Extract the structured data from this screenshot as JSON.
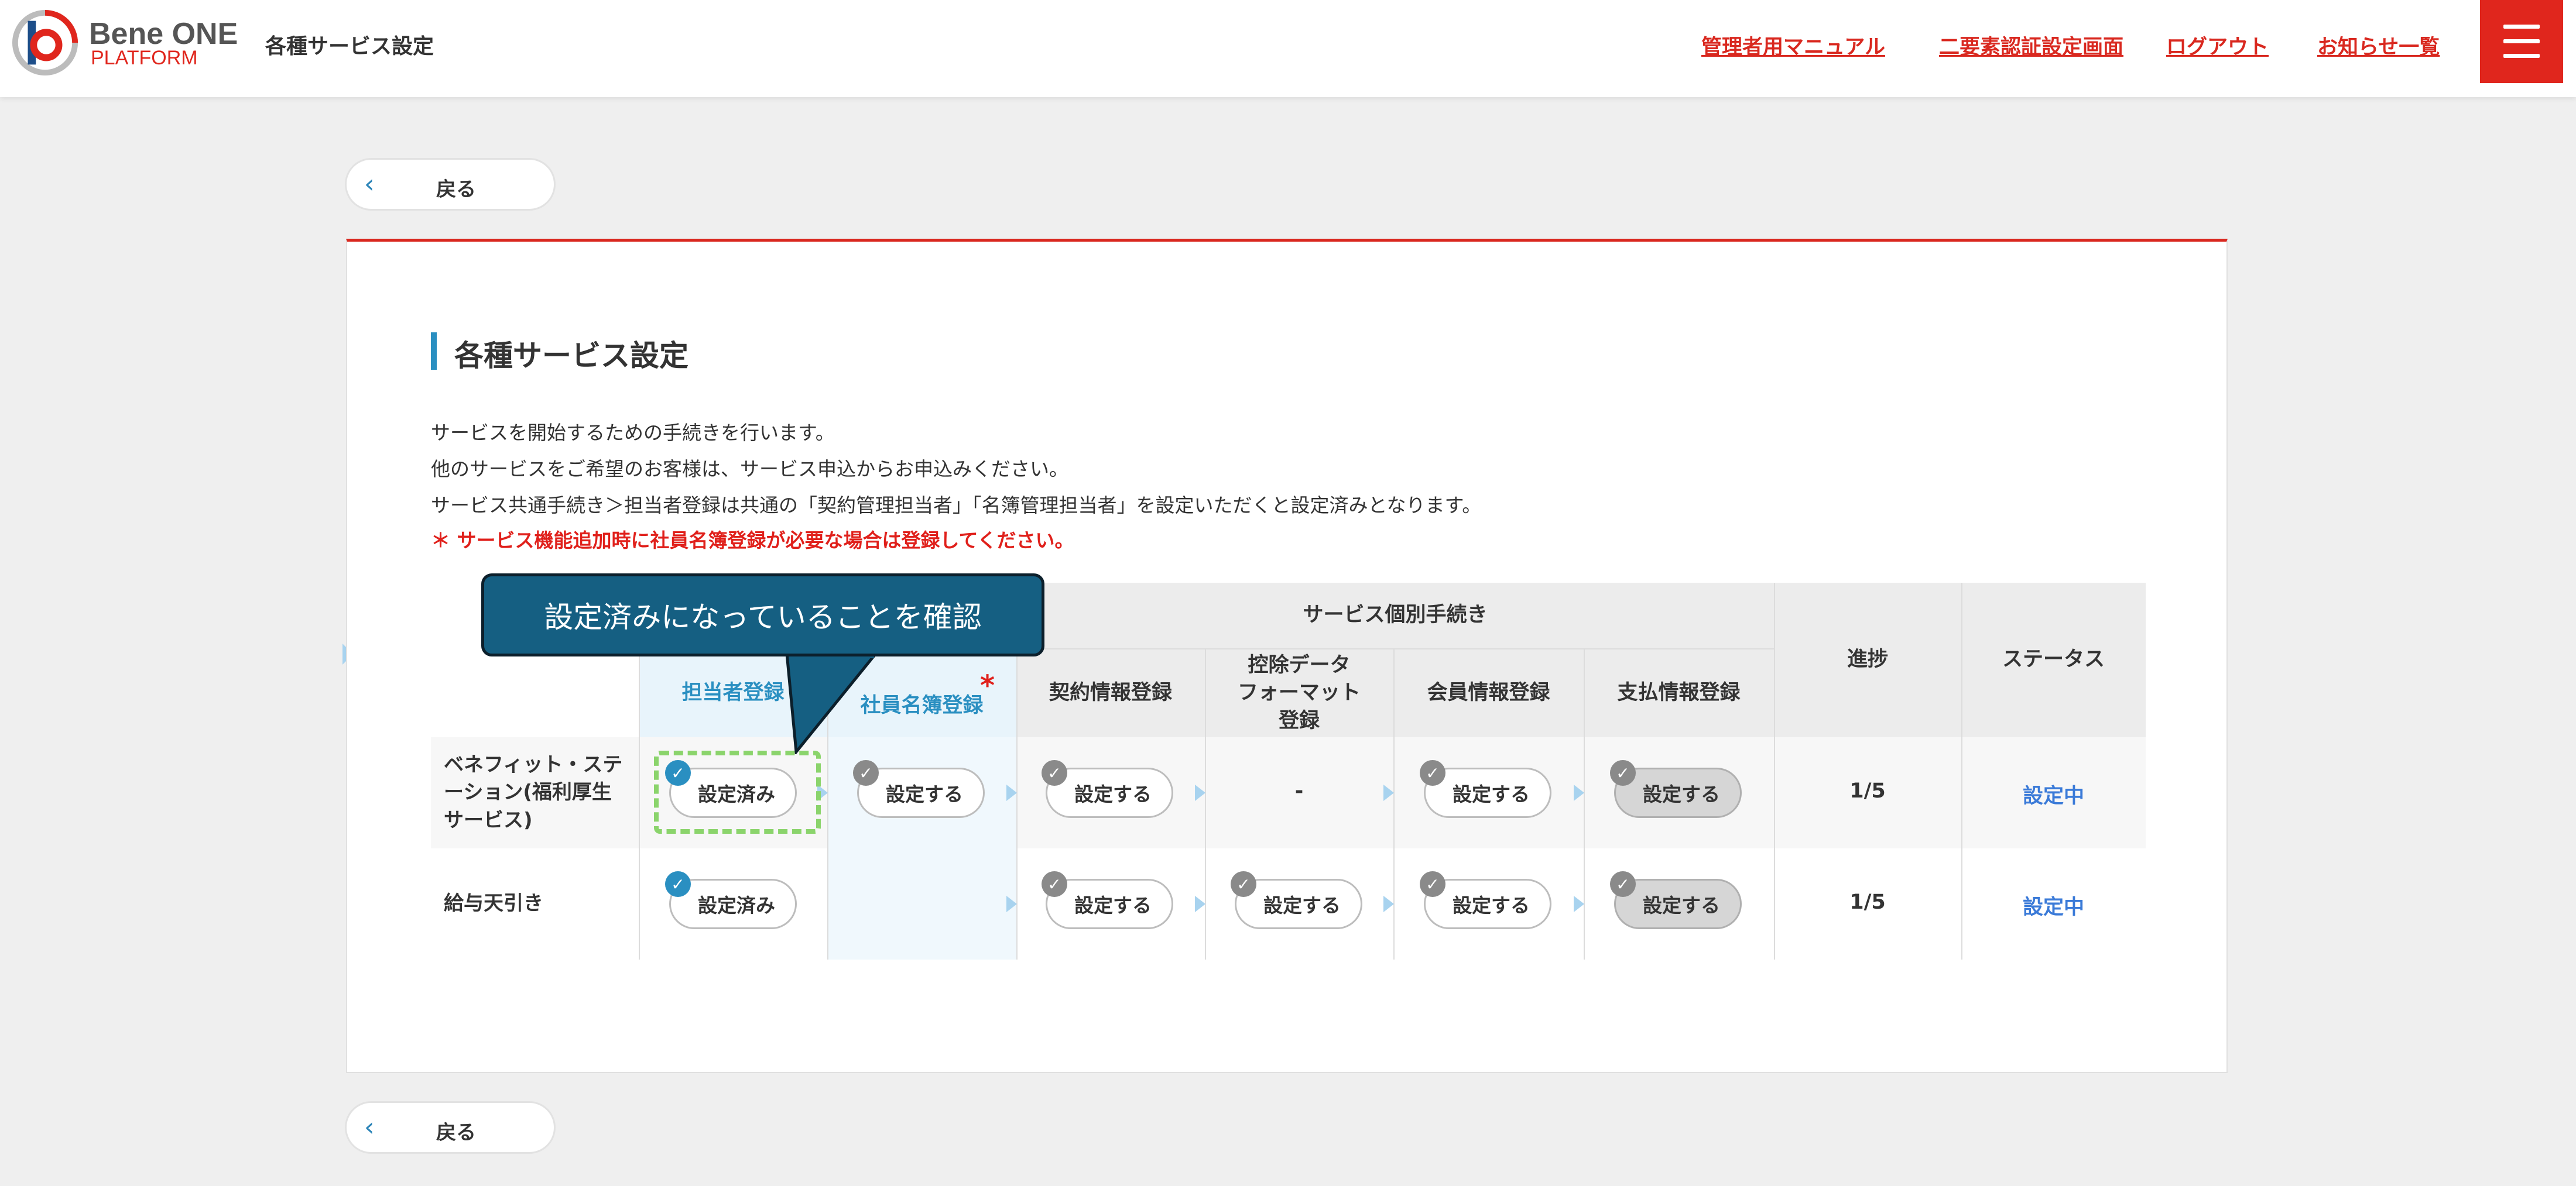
{
  "header": {
    "logo_line1": "Bene ONE",
    "logo_line2": "PLATFORM",
    "page_title": "各種サービス設定",
    "links": [
      "管理者用マニュアル",
      "二要素認証設定画面",
      "ログアウト",
      "お知らせ一覧"
    ],
    "menu_icon": "hamburger-menu-icon"
  },
  "back_label": "戻る",
  "section": {
    "title": "各種サービス設定",
    "desc_lines": [
      "サービスを開始するための手続きを行います。",
      "他のサービスをご希望のお客様は、サービス申込からお申込みください。",
      "サービス共通手続き＞担当者登録は共通の「契約管理担当者」「名簿管理担当者」を設定いただくと設定済みとなります。"
    ],
    "note": "＊ サービス機能追加時に社員名簿登録が必要な場合は登録してください。"
  },
  "table": {
    "group_header": "サービス個別手続き",
    "columns": {
      "tantou": "担当者登録",
      "meibo": "社員名簿登録",
      "meibo_mark": "*",
      "keiyaku": "契約情報登録",
      "koujo": "控除データ\nフォーマット\n登録",
      "kaiin": "会員情報登録",
      "shiharai": "支払情報登録",
      "progress": "進捗",
      "status": "ステータス"
    },
    "rows": [
      {
        "name": "ベネフィット・ステ\nーション(福利厚生\nサービス)",
        "tantou": "設定済み",
        "meibo": "設定する",
        "keiyaku": "設定する",
        "koujo": "-",
        "kaiin": "設定する",
        "shiharai": "設定する",
        "progress": "1/5",
        "status": "設定中"
      },
      {
        "name": "給与天引き",
        "tantou": "設定済み",
        "keiyaku": "設定する",
        "koujo": "設定する",
        "kaiin": "設定する",
        "shiharai": "設定する",
        "progress": "1/5",
        "status": "設定中"
      }
    ]
  },
  "callout": "設定済みになっていることを確認",
  "colors": {
    "brand_red": "#e0261d",
    "accent_blue": "#2a8fc1",
    "status_blue": "#3a7ad8",
    "callout_bg": "#155f82",
    "highlight_green": "#8bd46c"
  }
}
